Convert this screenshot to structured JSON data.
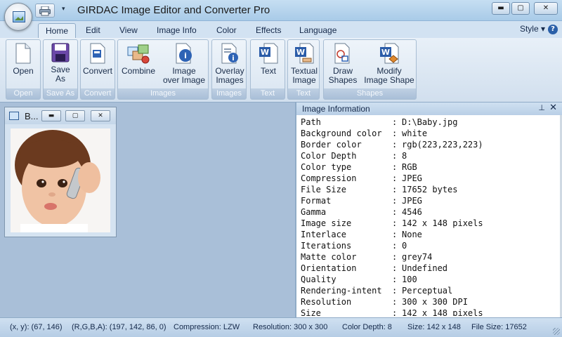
{
  "window": {
    "title": "GIRDAC Image Editor and Converter Pro",
    "minimize": "▬",
    "maximize": "▢",
    "close": "✕",
    "qat_arrow": "▾"
  },
  "tabs": [
    {
      "label": "Home",
      "active": true
    },
    {
      "label": "Edit"
    },
    {
      "label": "View"
    },
    {
      "label": "Image Info"
    },
    {
      "label": "Color"
    },
    {
      "label": "Effects"
    },
    {
      "label": "Language"
    }
  ],
  "style_menu": "Style ▾",
  "help": "?",
  "ribbon": {
    "open": {
      "label": "Open",
      "group": "Open"
    },
    "save_as": {
      "label1": "Save",
      "label2": "As",
      "group": "Save As"
    },
    "convert": {
      "label": "Convert",
      "group": "Convert"
    },
    "combine": {
      "label": "Combine"
    },
    "image_over_image": {
      "label1": "Image",
      "label2": "over Image"
    },
    "images_group": "Images",
    "overlay_images": {
      "label1": "Overlay",
      "label2": "Images",
      "group": "Images"
    },
    "text": {
      "label": "Text",
      "group": "Text"
    },
    "textual_image": {
      "label1": "Textual",
      "label2": "Image",
      "group": "Text"
    },
    "draw_shapes": {
      "label1": "Draw",
      "label2": "Shapes"
    },
    "modify_image_shape": {
      "label1": "Modify",
      "label2": "Image Shape"
    },
    "shapes_group": "Shapes"
  },
  "child_window": {
    "title": "B...",
    "minimize": "▬",
    "maximize": "▢",
    "close": "✕"
  },
  "info_panel": {
    "title": "Image Information",
    "pin": "📌",
    "close": "✕",
    "separator": ":",
    "rows": [
      {
        "key": "Path",
        "value": "D:\\Baby.jpg"
      },
      {
        "key": "Background color",
        "value": "white"
      },
      {
        "key": "Border color",
        "value": "rgb(223,223,223)"
      },
      {
        "key": "Color Depth",
        "value": "8"
      },
      {
        "key": "Color type",
        "value": "RGB"
      },
      {
        "key": "Compression",
        "value": "JPEG"
      },
      {
        "key": "File Size",
        "value": "17652 bytes"
      },
      {
        "key": "Format",
        "value": "JPEG"
      },
      {
        "key": "Gamma",
        "value": "4546"
      },
      {
        "key": "Image size",
        "value": "142 x 148 pixels"
      },
      {
        "key": "Interlace",
        "value": "None"
      },
      {
        "key": "Iterations",
        "value": "0"
      },
      {
        "key": "Matte color",
        "value": "grey74"
      },
      {
        "key": "Orientation",
        "value": "Undefined"
      },
      {
        "key": "Quality",
        "value": "100"
      },
      {
        "key": "Rendering-intent",
        "value": "Perceptual"
      },
      {
        "key": "Resolution",
        "value": "300 x 300 DPI"
      },
      {
        "key": "Size",
        "value": "142 x 148 pixels"
      }
    ]
  },
  "status": {
    "xy": "(x, y): (67, 146)",
    "rgba": "(R,G,B,A): (197, 142, 86, 0)",
    "compression": "Compression: LZW",
    "resolution": "Resolution: 300 x 300",
    "color_depth": "Color Depth: 8",
    "size": "Size: 142 x 148",
    "file_size": "File Size: 17652"
  },
  "colors": {
    "accent": "#2a5fa8",
    "ribbon_bg": "#d1dfee",
    "workspace_bg": "#a9bfd8"
  }
}
